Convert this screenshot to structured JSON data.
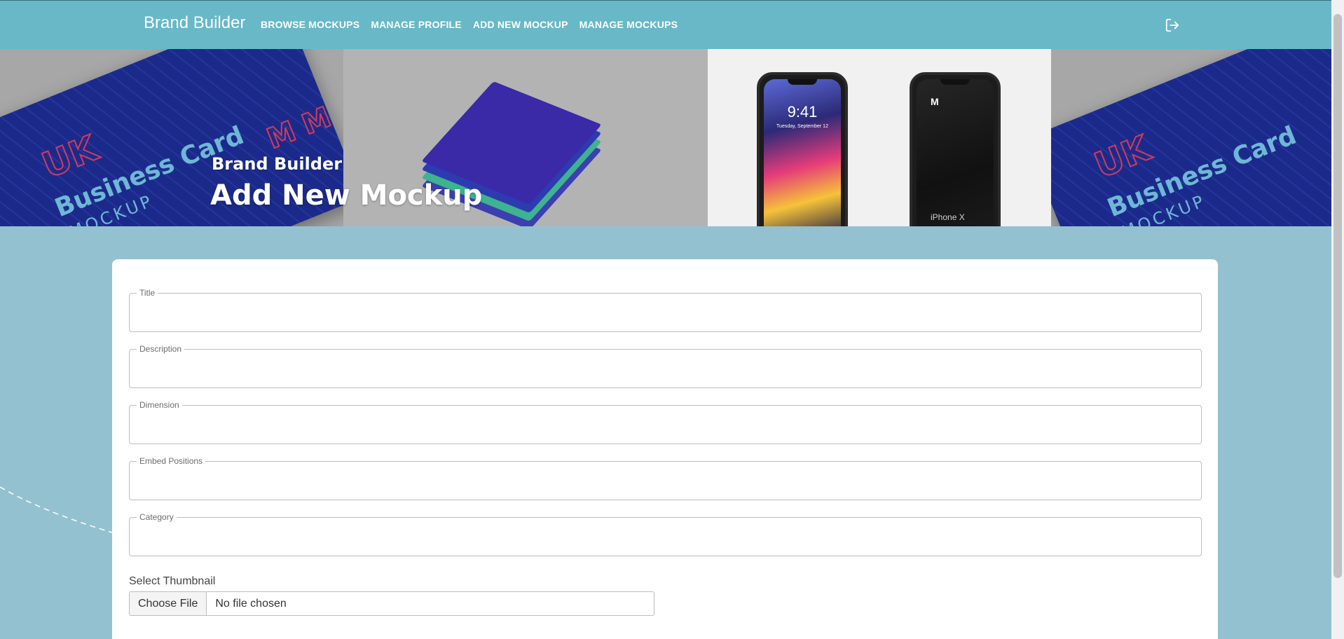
{
  "nav": {
    "brand": "Brand Builder",
    "links": [
      "BROWSE MOCKUPS",
      "MANAGE PROFILE",
      "ADD NEW MOCKUP",
      "MANAGE MOCKUPS"
    ],
    "logout_icon": "logout-icon"
  },
  "hero": {
    "subtitle": "Brand Builder",
    "title": "Add New Mockup",
    "card_text_uk": "UK",
    "card_text_business": "Business Card",
    "card_text_mockup": "MOCKUP",
    "phone_time": "9:41",
    "phone_date": "Tuesday, September 12",
    "phone_logo": "M",
    "phone_model": "iPhone X"
  },
  "form": {
    "fields": [
      {
        "label": "Title",
        "value": ""
      },
      {
        "label": "Description",
        "value": ""
      },
      {
        "label": "Dimension",
        "value": ""
      },
      {
        "label": "Embed Positions",
        "value": ""
      },
      {
        "label": "Category",
        "value": ""
      }
    ],
    "thumbnail_label": "Select Thumbnail",
    "file_button": "Choose File",
    "file_status": "No file chosen"
  },
  "colors": {
    "navbar": "#68b8c8",
    "background": "#94c1cf",
    "card": "#ffffff"
  }
}
